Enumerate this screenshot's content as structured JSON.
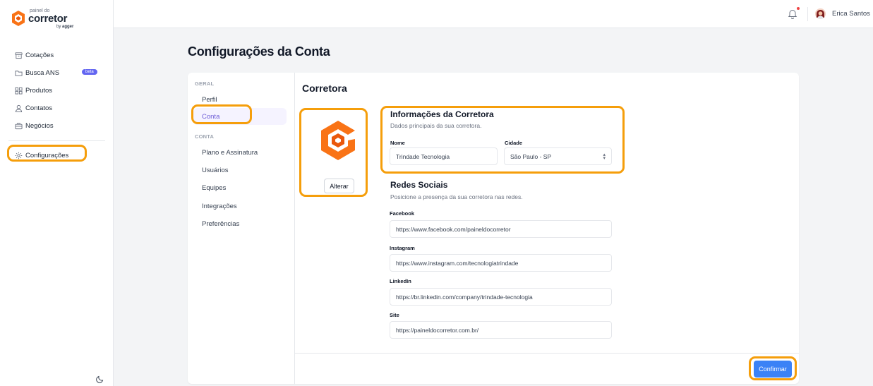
{
  "app": {
    "logo_small": "painel do",
    "logo_big": "corretor",
    "logo_by": "by",
    "logo_by_brand": "agger"
  },
  "sidebar": {
    "items": [
      {
        "label": "Cotações",
        "icon": "archive-icon"
      },
      {
        "label": "Busca ANS",
        "icon": "folder-icon",
        "badge": "beta"
      },
      {
        "label": "Produtos",
        "icon": "grid-icon"
      },
      {
        "label": "Contatos",
        "icon": "user-icon"
      },
      {
        "label": "Negócios",
        "icon": "briefcase-icon"
      }
    ],
    "config_label": "Configurações"
  },
  "topbar": {
    "user_name": "Erica Santos"
  },
  "page": {
    "title": "Configurações da Conta"
  },
  "menu": {
    "group_geral": "GERAL",
    "perfil": "Perfil",
    "conta": "Conta",
    "group_conta": "CONTA",
    "plano": "Plano e Assinatura",
    "usuarios": "Usuários",
    "equipes": "Equipes",
    "integracoes": "Integrações",
    "preferencias": "Preferências"
  },
  "content": {
    "section_title": "Corretora",
    "alterar_label": "Alterar",
    "info": {
      "title": "Informações da Corretora",
      "desc": "Dados principais da sua corretora.",
      "nome_label": "Nome",
      "nome_value": "Trindade Tecnologia",
      "cidade_label": "Cidade",
      "cidade_value": "São Paulo - SP"
    },
    "social": {
      "title": "Redes Sociais",
      "desc": "Posicione a presença da sua corretora nas redes.",
      "facebook_label": "Facebook",
      "facebook_value": "https://www.facebook.com/paineldocorretor",
      "instagram_label": "Instagram",
      "instagram_value": "https://www.instagram.com/tecnologiatrindade",
      "linkedin_label": "LinkedIn",
      "linkedin_value": "https://br.linkedin.com/company/trindade-tecnologia",
      "site_label": "Site",
      "site_value": "https://paineldocorretor.com.br/"
    },
    "confirm_label": "Confirmar"
  },
  "colors": {
    "accent": "#f59e0b",
    "primary": "#3b82f6",
    "active_menu": "#6d5cd6",
    "logo_orange": "#f97316"
  }
}
